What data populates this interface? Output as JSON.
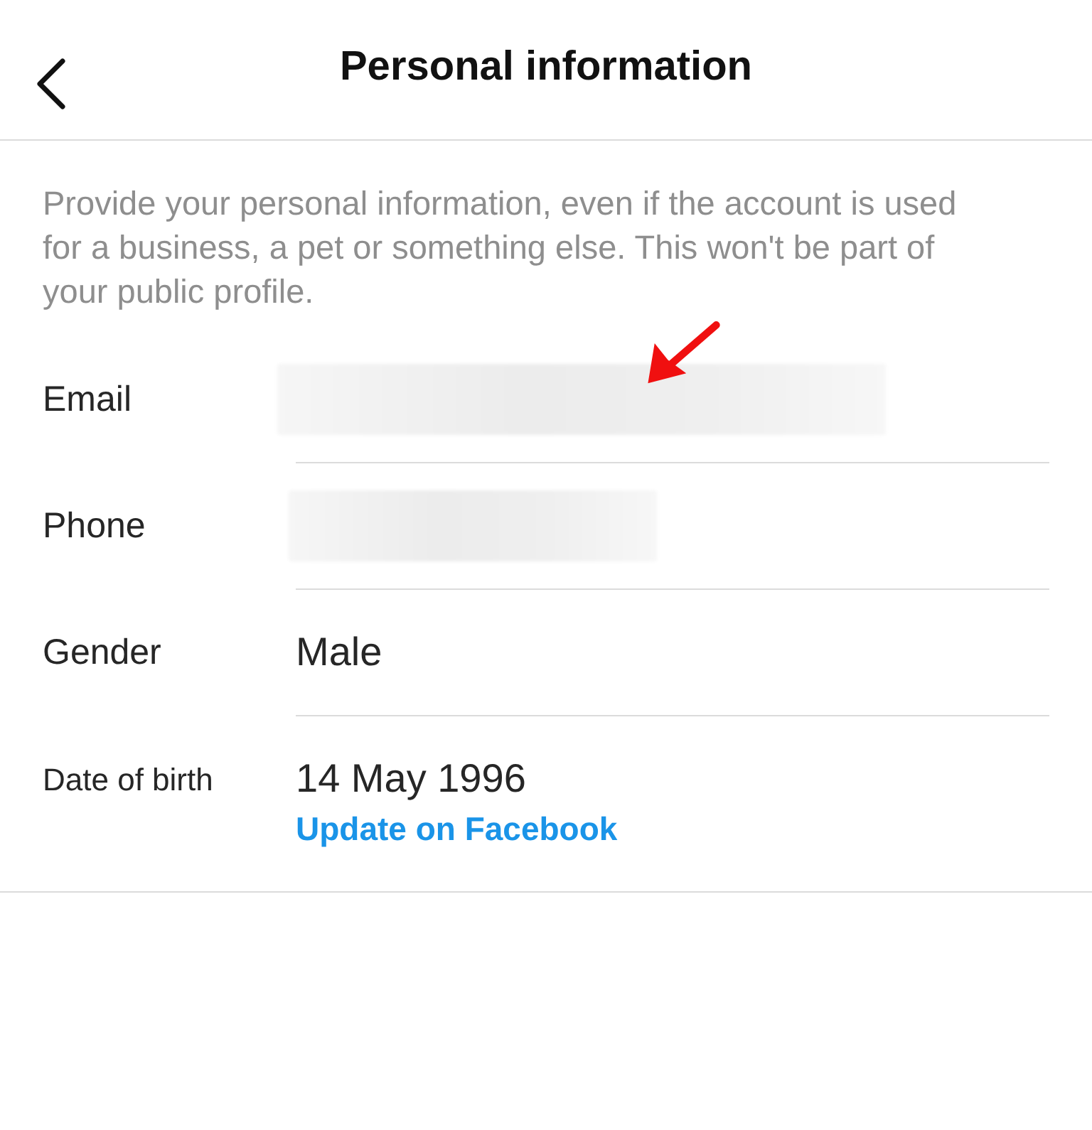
{
  "header": {
    "title": "Personal information"
  },
  "description": "Provide your personal information, even if the account is used for a business, a pet or something else. This won't be part of your public profile.",
  "fields": [
    {
      "label": "Email",
      "kind": "blurred"
    },
    {
      "label": "Phone",
      "kind": "blurred"
    },
    {
      "label": "Gender",
      "kind": "text",
      "value": "Male"
    },
    {
      "label": "Date of birth",
      "kind": "text",
      "value": "14 May 1996",
      "link": "Update on Facebook"
    }
  ]
}
